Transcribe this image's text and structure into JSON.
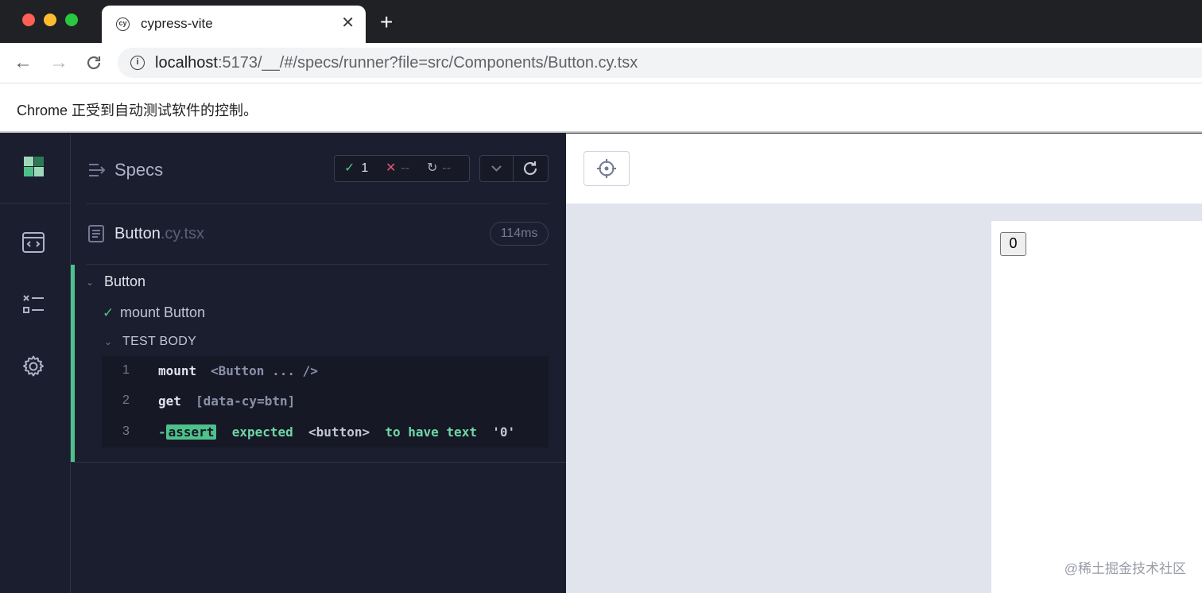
{
  "browser": {
    "tab_title": "cypress-vite",
    "favicon_text": "cy",
    "tab_close": "✕",
    "new_tab": "+",
    "url_host": "localhost",
    "url_rest": ":5173/__/#/specs/runner?file=src/Components/Button.cy.tsx",
    "infobar": "Chrome 正受到自动测试软件的控制。"
  },
  "reporter": {
    "header_label": "Specs",
    "stats": {
      "passed": "1",
      "failed": "--",
      "pending": "--"
    },
    "file": {
      "name": "Button",
      "ext": ".cy.tsx",
      "duration": "114ms"
    },
    "suite": {
      "title": "Button"
    },
    "test": {
      "title": "mount Button",
      "body_label": "TEST BODY"
    },
    "commands": [
      {
        "num": "1",
        "name": "mount",
        "message": "<Button ... />"
      },
      {
        "num": "2",
        "name": "get",
        "message": "[data-cy=btn]"
      },
      {
        "num": "3",
        "prefix": "-",
        "name": "assert",
        "w_expected": "expected",
        "w_subject": "<button>",
        "w_to": "to have text",
        "w_value": "'0'"
      }
    ]
  },
  "aut": {
    "button_text": "0"
  },
  "watermark": "@稀土掘金技术社区",
  "colors": {
    "pass": "#4ec18b",
    "fail": "#e45770",
    "background": "#1b1e2e",
    "aut_background": "#e1e3ed"
  }
}
